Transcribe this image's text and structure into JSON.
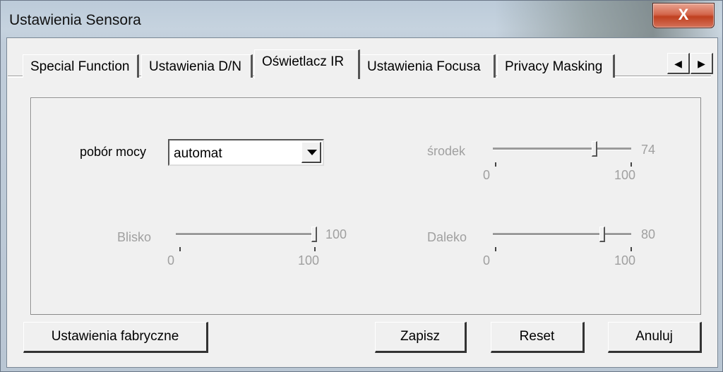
{
  "window": {
    "title": "Ustawienia Sensora",
    "close_glyph": "X"
  },
  "tabs": [
    {
      "label": "Special Function"
    },
    {
      "label": "Ustawienia D/N"
    },
    {
      "label": "Oświetlacz IR",
      "active": true
    },
    {
      "label": "Ustawienia Focusa"
    },
    {
      "label": "Privacy Masking"
    }
  ],
  "tab_scroll": {
    "left_glyph": "◀",
    "right_glyph": "▶"
  },
  "power": {
    "label": "pobór mocy",
    "value": "automat"
  },
  "sliders": {
    "srodek": {
      "label": "środek",
      "value": "74",
      "min": "0",
      "max": "100",
      "level": 0.74
    },
    "blisko": {
      "label": "Blisko",
      "value": "100",
      "min": "0",
      "max": "100",
      "level": 1.0
    },
    "daleko": {
      "label": "Daleko",
      "value": "80",
      "min": "0",
      "max": "100",
      "level": 0.8
    }
  },
  "buttons": {
    "factory": "Ustawienia fabryczne",
    "save": "Zapisz",
    "reset": "Reset",
    "cancel": "Anuluj"
  }
}
